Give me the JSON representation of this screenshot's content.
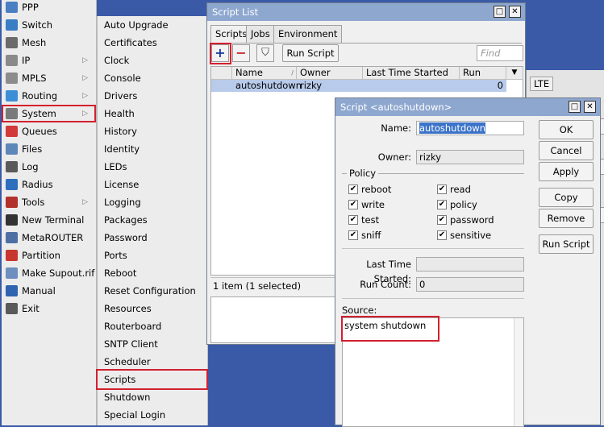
{
  "main_menu": [
    {
      "label": "PPP",
      "icon": "ppp-icon",
      "color": "#4a7fc1"
    },
    {
      "label": "Switch",
      "icon": "switch-icon",
      "color": "#3b7dc4"
    },
    {
      "label": "Mesh",
      "icon": "mesh-icon",
      "color": "#6b6b6b"
    },
    {
      "label": "IP",
      "icon": "ip-icon",
      "color": "#8a8a8a",
      "arrow": true
    },
    {
      "label": "MPLS",
      "icon": "mpls-icon",
      "color": "#8c8c8c",
      "arrow": true
    },
    {
      "label": "Routing",
      "icon": "routing-icon",
      "color": "#3c8fd6",
      "arrow": true
    },
    {
      "label": "System",
      "icon": "system-gear-icon",
      "color": "#7a7a7a",
      "arrow": true,
      "highlight": true
    },
    {
      "label": "Queues",
      "icon": "queues-icon",
      "color": "#d23a3a"
    },
    {
      "label": "Files",
      "icon": "files-icon",
      "color": "#5f86b8"
    },
    {
      "label": "Log",
      "icon": "log-icon",
      "color": "#5a5a5a"
    },
    {
      "label": "Radius",
      "icon": "radius-icon",
      "color": "#2e6fbd"
    },
    {
      "label": "Tools",
      "icon": "tools-icon",
      "color": "#b3312c",
      "arrow": true
    },
    {
      "label": "New Terminal",
      "icon": "terminal-icon",
      "color": "#333333"
    },
    {
      "label": "MetaROUTER",
      "icon": "metarouter-icon",
      "color": "#4d6fa3"
    },
    {
      "label": "Partition",
      "icon": "partition-icon",
      "color": "#c7372f"
    },
    {
      "label": "Make Supout.rif",
      "icon": "supout-icon",
      "color": "#6c8fbf"
    },
    {
      "label": "Manual",
      "icon": "manual-icon",
      "color": "#3063b0"
    },
    {
      "label": "Exit",
      "icon": "exit-icon",
      "color": "#5a5a5a"
    }
  ],
  "sub_menu": [
    {
      "label": "Auto Upgrade"
    },
    {
      "label": "Certificates"
    },
    {
      "label": "Clock"
    },
    {
      "label": "Console"
    },
    {
      "label": "Drivers"
    },
    {
      "label": "Health"
    },
    {
      "label": "History"
    },
    {
      "label": "Identity"
    },
    {
      "label": "LEDs"
    },
    {
      "label": "License"
    },
    {
      "label": "Logging"
    },
    {
      "label": "Packages"
    },
    {
      "label": "Password"
    },
    {
      "label": "Ports"
    },
    {
      "label": "Reboot"
    },
    {
      "label": "Reset Configuration"
    },
    {
      "label": "Resources"
    },
    {
      "label": "Routerboard"
    },
    {
      "label": "SNTP Client"
    },
    {
      "label": "Scheduler"
    },
    {
      "label": "Scripts",
      "highlight": true
    },
    {
      "label": "Shutdown"
    },
    {
      "label": "Special Login"
    }
  ],
  "script_list": {
    "title": "Script List",
    "tabs": [
      "Scripts",
      "Jobs",
      "Environment"
    ],
    "add_glyph": "+",
    "remove_glyph": "−",
    "filter_glyph": "⛉",
    "run_label": "Run Script",
    "find_placeholder": "Find",
    "columns": [
      "Name",
      "Owner",
      "Last Time Started",
      "Run Count"
    ],
    "rows": [
      {
        "name": "autoshutdown",
        "owner": "rizky",
        "last_started": "",
        "run_count": "0"
      }
    ],
    "status": "1 item (1 selected)"
  },
  "bg_window": {
    "tab_label": "LTE"
  },
  "script_dialog": {
    "title": "Script <autoshutdown>",
    "name_label": "Name:",
    "name_value": "autoshutdown",
    "owner_label": "Owner:",
    "owner_value": "rizky",
    "policy_label": "Policy",
    "policies": [
      {
        "label": "reboot",
        "checked": true
      },
      {
        "label": "read",
        "checked": true
      },
      {
        "label": "write",
        "checked": true
      },
      {
        "label": "policy",
        "checked": true
      },
      {
        "label": "test",
        "checked": true
      },
      {
        "label": "password",
        "checked": true
      },
      {
        "label": "sniff",
        "checked": true
      },
      {
        "label": "sensitive",
        "checked": true
      }
    ],
    "last_started_label": "Last Time Started:",
    "last_started_value": "",
    "run_count_label": "Run Count:",
    "run_count_value": "0",
    "source_label": "Source:",
    "source_value": "system shutdown",
    "buttons": {
      "ok": "OK",
      "cancel": "Cancel",
      "apply": "Apply",
      "copy": "Copy",
      "remove": "Remove",
      "run": "Run Script"
    },
    "check_glyph": "✔",
    "min_glyph": "□",
    "close_glyph": "✕"
  },
  "colors": {
    "highlight": "#d2202f",
    "titlebar": "#8ea7cf",
    "selection": "#b9cbeb",
    "desktop": "#3a5aa8"
  }
}
